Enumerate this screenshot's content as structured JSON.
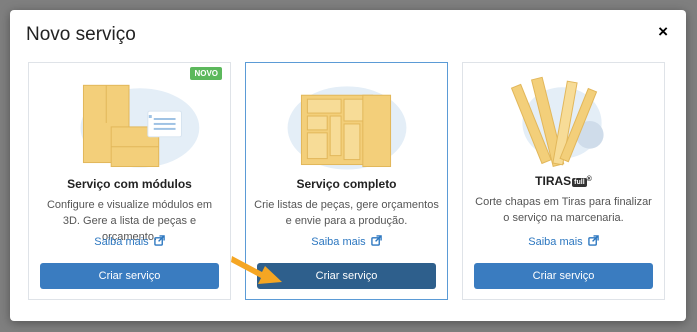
{
  "modal": {
    "title": "Novo serviço",
    "close_label": "×"
  },
  "cards": [
    {
      "badge": "NOVO",
      "title": "Serviço com módulos",
      "description": "Configure e visualize módulos em 3D. Gere a lista de peças e orçamento.",
      "link": "Saiba mais",
      "button": "Criar serviço"
    },
    {
      "title": "Serviço completo",
      "description": "Crie listas de peças, gere orçamentos e envie para a produção.",
      "link": "Saiba mais",
      "button": "Criar serviço"
    },
    {
      "logo_text": "TIRAS",
      "logo_tag": "full",
      "logo_reg": "®",
      "description": "Corte chapas em Tiras para finalizar o serviço na marcenaria.",
      "link": "Saiba mais",
      "button": "Criar serviço"
    }
  ],
  "colors": {
    "primary_button": "#3a7cc0",
    "active_button": "#2e5f8c",
    "badge": "#5cb85c",
    "link": "#2c77c0",
    "arrow": "#f5a623",
    "illustration_wood": "#f3cf7a",
    "illustration_bg": "#e4eef7"
  },
  "icons": [
    "close-icon",
    "external-link-icon",
    "pointer-arrow-icon"
  ]
}
